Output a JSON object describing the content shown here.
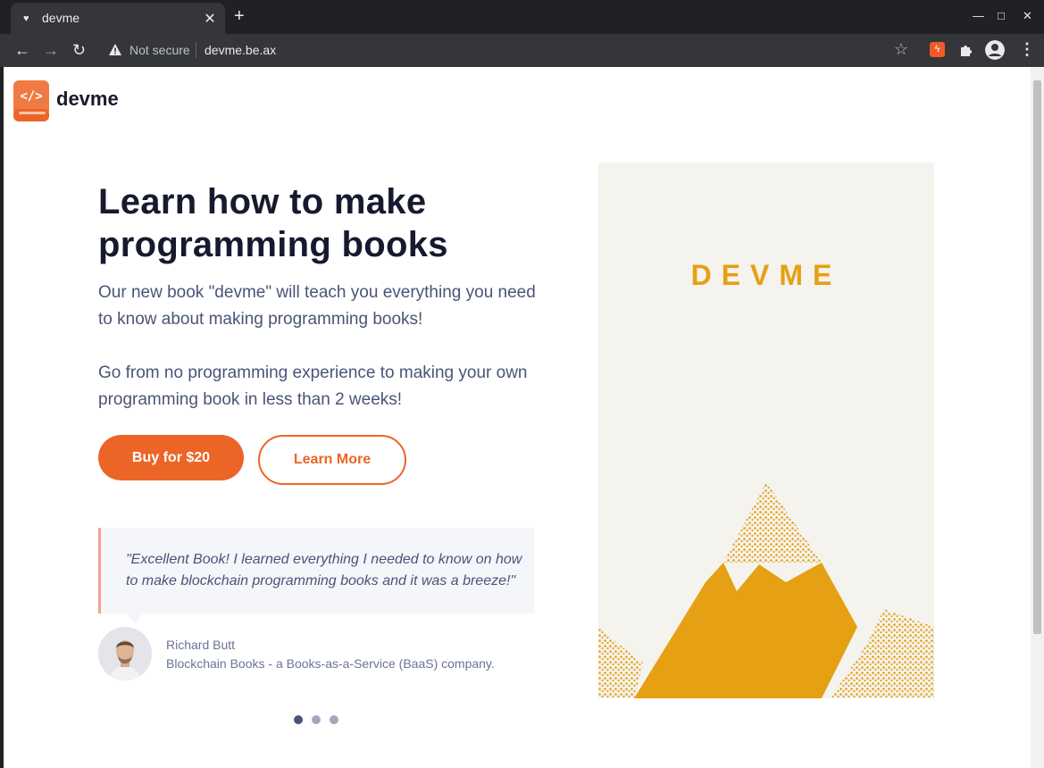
{
  "browser": {
    "tab_title": "devme",
    "tab_close": "✕",
    "new_tab": "+",
    "security_label": "Not secure",
    "url": "devme.be.ax",
    "minimize": "—",
    "maximize": "□",
    "close": "✕"
  },
  "brand": {
    "name": "devme",
    "accent": "#ec6526",
    "cover_color": "#e6a013"
  },
  "hero": {
    "heading": "Learn how to make programming books",
    "para1": "Our new book \"devme\" will teach you everything you need to know about making programming books!",
    "para2": "Go from no programming experience to making your own programming book in less than 2 weeks!",
    "buy_label": "Buy for $20",
    "learn_label": "Learn More"
  },
  "testimonial": {
    "quote": "\"Excellent Book! I learned everything I needed to know on how to make blockchain programming books and it was a breeze!\"",
    "author": "Richard Butt",
    "company": "Blockchain Books - a Books-as-a-Service (BaaS) company.",
    "slides_total": 3,
    "active_slide": 1
  },
  "cover": {
    "title": "DEVME"
  },
  "icons": {
    "tab_favicon": "heart-icon",
    "back": "arrow-left-icon",
    "forward": "arrow-right-icon",
    "reload": "reload-icon",
    "security": "warning-icon",
    "bookmark": "star-icon",
    "extension": "puzzle-icon",
    "profile": "account-icon",
    "menu": "kebab-menu-icon"
  }
}
